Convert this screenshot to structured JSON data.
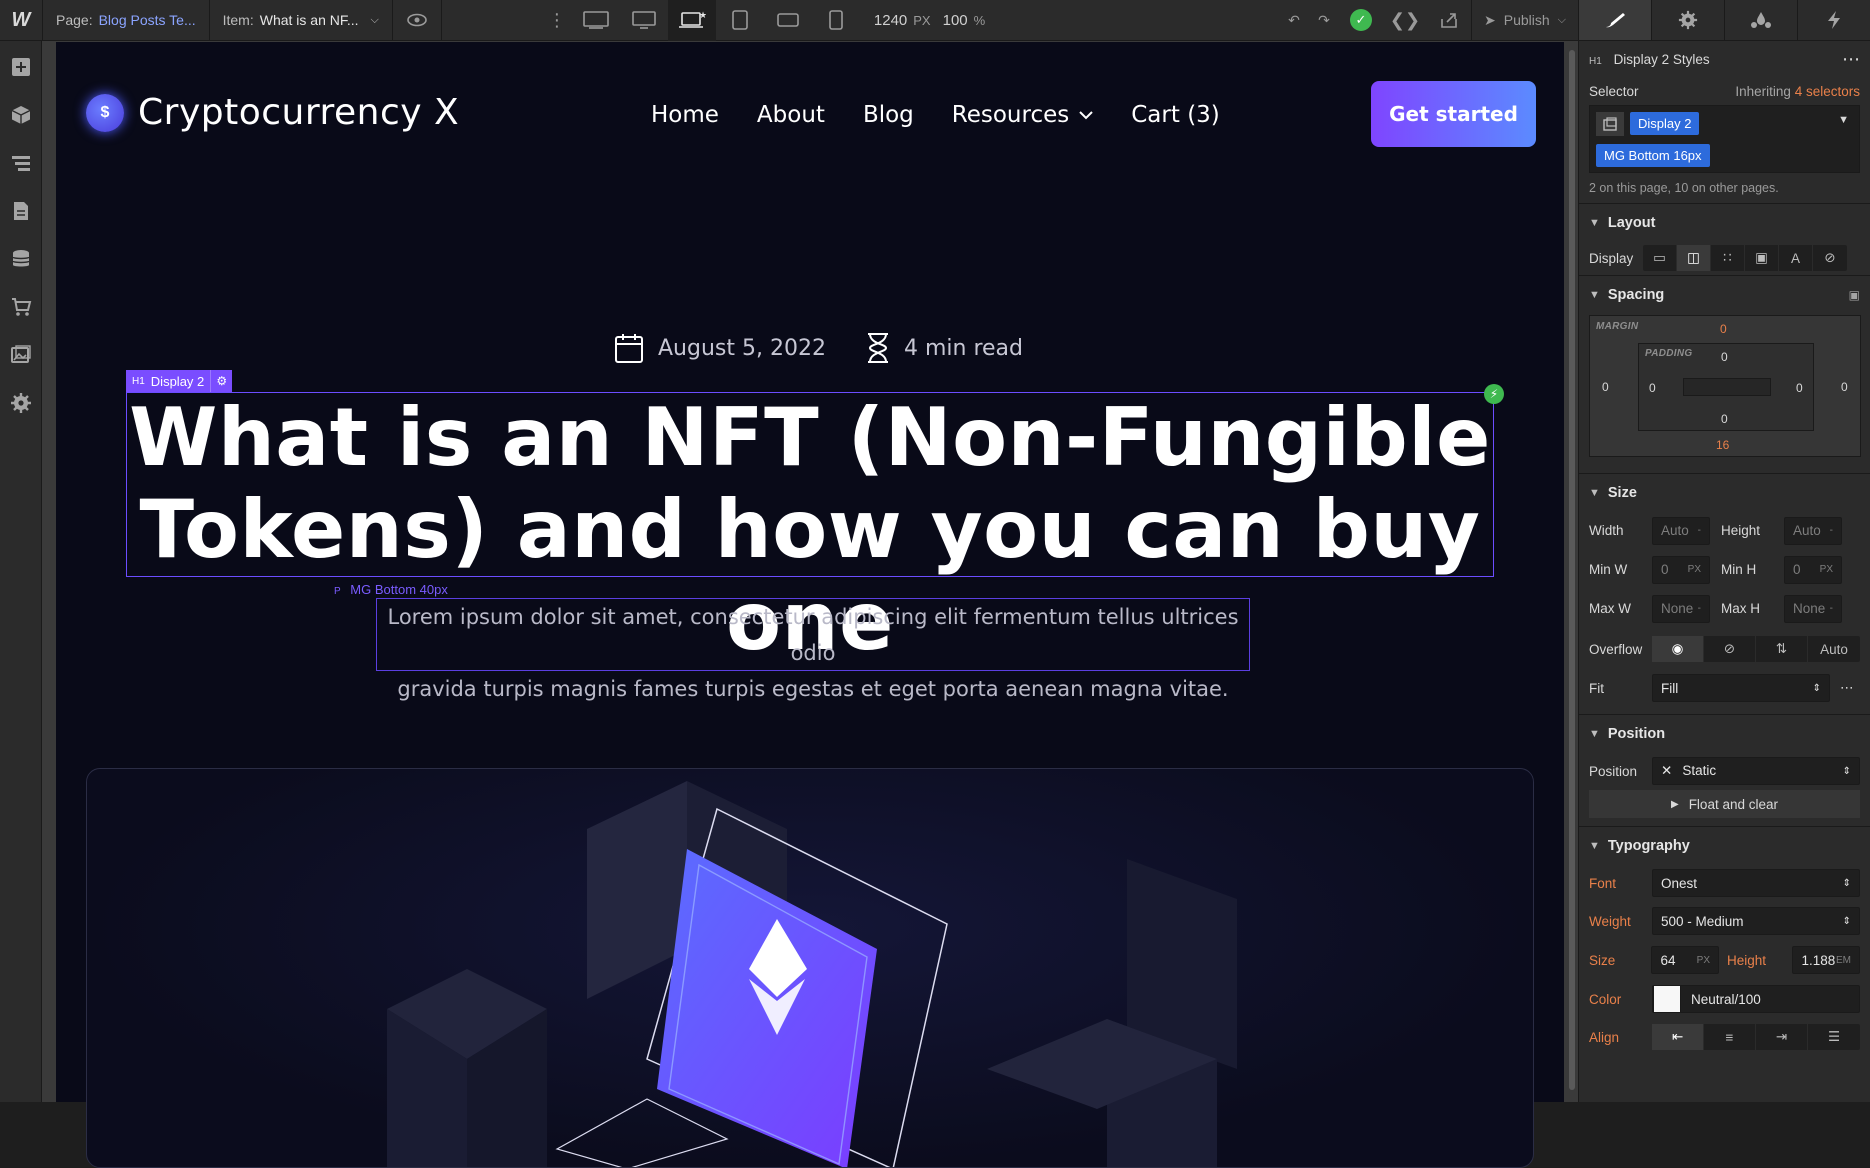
{
  "topbar": {
    "logo": "W",
    "page_label": "Page:",
    "page_value": "Blog Posts Te...",
    "item_label": "Item:",
    "item_value": "What is an NF...",
    "canvas_width": "1240",
    "canvas_width_unit": "PX",
    "zoom": "100",
    "zoom_unit": "%",
    "publish": "Publish"
  },
  "site": {
    "brand": "Cryptocurrency X",
    "coin_symbol": "$",
    "nav": [
      "Home",
      "About",
      "Blog",
      "Resources",
      "Cart (3)"
    ],
    "cta": "Get started",
    "date": "August 5, 2022",
    "read_time": "4 min read",
    "heading_tag_type": "H1",
    "heading_tag_class": "Display 2",
    "headline_line1": "What is an NFT (Non-Fungible",
    "headline_line2": "Tokens) and how you can buy one",
    "p_tag_type": "P",
    "p_tag_class": "MG Bottom 40px",
    "lead_line1": "Lorem ipsum dolor sit amet, consectetur adipiscing elit fermentum tellus ultrices odio",
    "lead_line2": "gravida turpis magnis fames turpis egestas et eget porta aenean magna vitae."
  },
  "panel": {
    "element_tag": "H1",
    "title": "Display 2 Styles",
    "selector_label": "Selector",
    "inheriting_label": "Inheriting",
    "inheriting_count": "4 selectors",
    "selector_chip1": "Display 2",
    "selector_chip2": "MG Bottom 16px",
    "selector_note": "2 on this page, 10 on other pages.",
    "layout_header": "Layout",
    "display_label": "Display",
    "spacing_header": "Spacing",
    "margin_label": "MARGIN",
    "padding_label": "PADDING",
    "margin": {
      "top": "0",
      "right": "0",
      "bottom": "16",
      "left": "0"
    },
    "padding": {
      "top": "0",
      "right": "0",
      "bottom": "0",
      "left": "0"
    },
    "size_header": "Size",
    "width_label": "Width",
    "height_label": "Height",
    "min_w_label": "Min W",
    "min_h_label": "Min H",
    "max_w_label": "Max W",
    "max_h_label": "Max H",
    "width_val": "Auto",
    "height_val": "Auto",
    "min_w_val": "0",
    "min_h_val": "0",
    "max_w_val": "None",
    "max_h_val": "None",
    "px": "PX",
    "dash": "-",
    "overflow_label": "Overflow",
    "overflow_auto": "Auto",
    "fit_label": "Fit",
    "fit_val": "Fill",
    "position_header": "Position",
    "position_label": "Position",
    "position_val": "Static",
    "float_clear": "Float and clear",
    "typography_header": "Typography",
    "font_label": "Font",
    "font_val": "Onest",
    "weight_label": "Weight",
    "weight_val": "500 - Medium",
    "size_label": "Size",
    "size_val": "64",
    "size_unit": "PX",
    "line_height_label": "Height",
    "line_height_val": "1.188",
    "line_height_unit": "EM",
    "color_label": "Color",
    "color_val": "Neutral/100",
    "align_label": "Align"
  },
  "colors": {
    "accent": "#7a4dff",
    "selector_blue": "#2d6bdc",
    "override_orange": "#e9804a",
    "success": "#3fb950"
  }
}
